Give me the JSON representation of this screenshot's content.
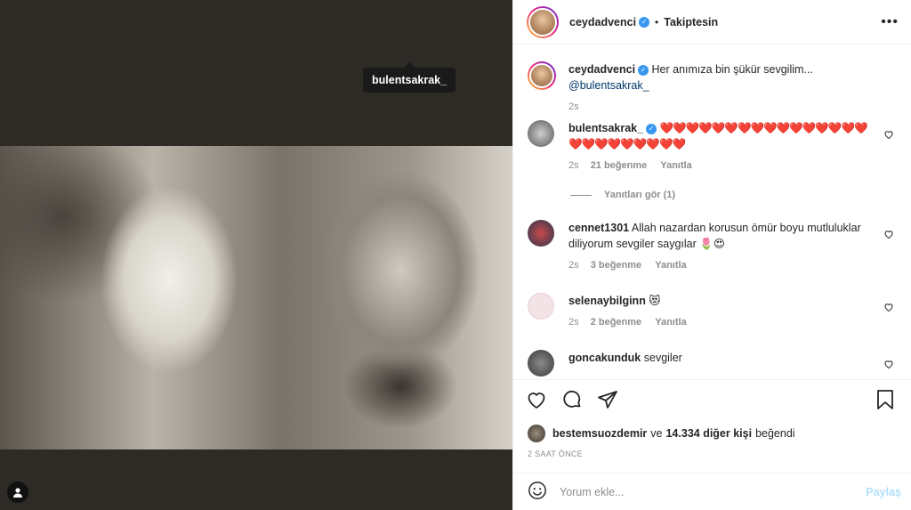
{
  "tag_label": "bulentsakrak_",
  "header": {
    "username": "ceydadvenci",
    "follow_state": "Takiptesin",
    "more_icon": "more-horizontal-icon"
  },
  "caption": {
    "username": "ceydadvenci",
    "text": "Her anımıza bin şükür sevgilim...",
    "mention": "@bulentsakrak_",
    "time": "2s"
  },
  "comments": [
    {
      "username": "bulentsakrak_",
      "verified": true,
      "text": "❤️❤️❤️❤️❤️❤️❤️❤️❤️❤️❤️❤️❤️❤️❤️❤️❤️❤️❤️❤️❤️❤️❤️❤️❤️",
      "time": "2s",
      "likes": "21 beğenme",
      "reply": "Yanıtla",
      "view_replies": "Yanıtları gör (1)"
    },
    {
      "username": "cennet1301",
      "text": "Allah nazardan korusun ömür boyu mutluluklar diliyorum sevgiler saygılar 🌷😍",
      "time": "2s",
      "likes": "3 beğenme",
      "reply": "Yanıtla"
    },
    {
      "username": "selenaybilginn",
      "text": "😻",
      "time": "2s",
      "likes": "2 beğenme",
      "reply": "Yanıtla"
    },
    {
      "username": "goncakunduk",
      "text": "sevgiler"
    }
  ],
  "liked_by": {
    "user": "bestemsuozdemir",
    "connector": "ve",
    "others": "14.334 diğer kişi",
    "suffix": "beğendi"
  },
  "post_time": "2 SAAT ÖNCE",
  "add_comment": {
    "placeholder": "Yorum ekle...",
    "post_label": "Paylaş"
  },
  "colors": {
    "verified": "#3897f0",
    "post_button_disabled": "#b2dffc",
    "heart": "#e0101e"
  }
}
